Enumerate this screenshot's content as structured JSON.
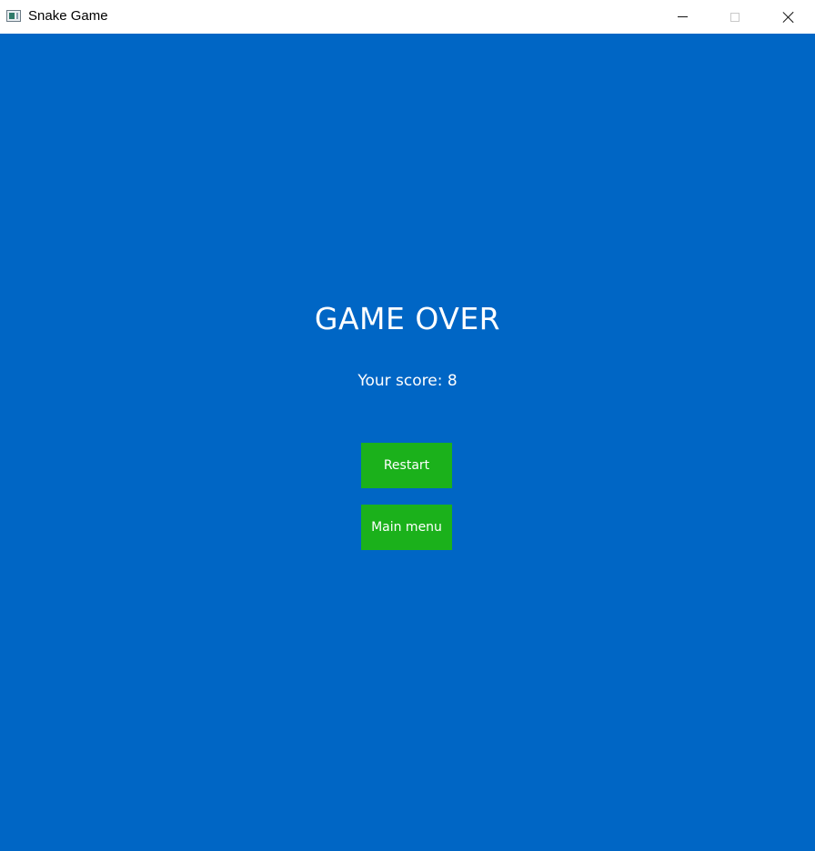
{
  "window": {
    "title": "Snake Game",
    "icons": [
      "app-icon",
      "minimize-icon",
      "maximize-icon",
      "close-icon"
    ]
  },
  "game": {
    "heading": "GAME OVER",
    "score_text": "Your score: 8",
    "restart_label": "Restart",
    "main_menu_label": "Main menu"
  },
  "colors": {
    "background": "#0066c5",
    "button": "#1bb11b",
    "text": "#ffffff"
  }
}
